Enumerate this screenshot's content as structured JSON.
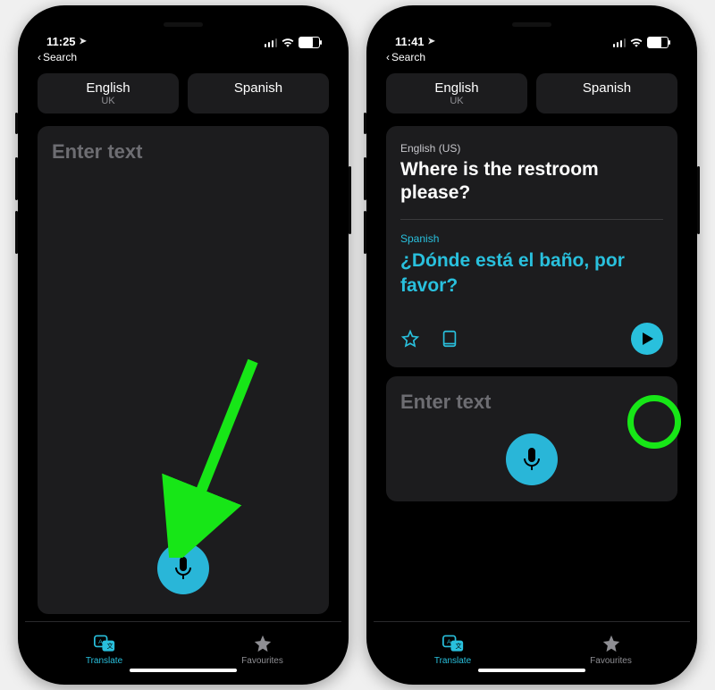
{
  "left": {
    "status_time": "11:25",
    "back_label": "Search",
    "lang_from": "English",
    "lang_from_sub": "UK",
    "lang_to": "Spanish",
    "input_placeholder": "Enter text",
    "tab_translate": "Translate",
    "tab_favourites": "Favourites"
  },
  "right": {
    "status_time": "11:41",
    "back_label": "Search",
    "lang_from": "English",
    "lang_from_sub": "UK",
    "lang_to": "Spanish",
    "source_lang_label": "English (US)",
    "source_text": "Where is the restroom please?",
    "target_lang_label": "Spanish",
    "target_text": "¿Dónde está el baño, por favor?",
    "input_placeholder": "Enter text",
    "tab_translate": "Translate",
    "tab_favourites": "Favourites"
  },
  "colors": {
    "accent": "#29c0dd",
    "annotation": "#17e617",
    "panel": "#1c1c1e"
  }
}
